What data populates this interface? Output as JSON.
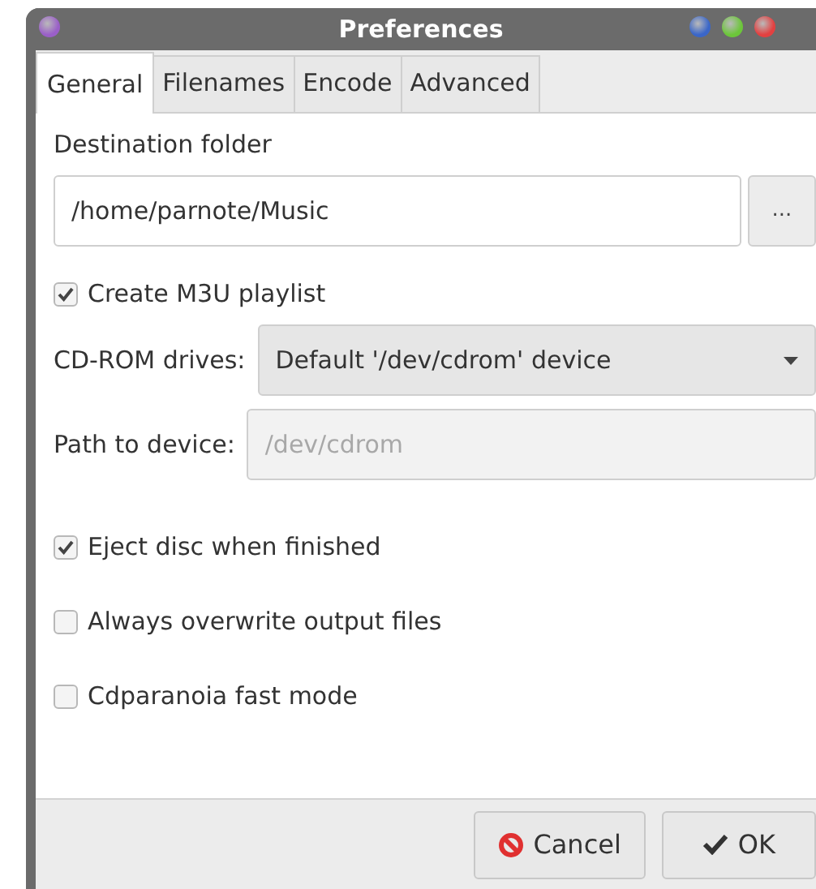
{
  "window": {
    "title": "Preferences"
  },
  "tabs": [
    {
      "label": "General",
      "selected": true
    },
    {
      "label": "Filenames",
      "selected": false
    },
    {
      "label": "Encode",
      "selected": false
    },
    {
      "label": "Advanced",
      "selected": false
    }
  ],
  "rows": [
    {
      "kind": "heading",
      "label": "Destination folder"
    },
    {
      "kind": "folder",
      "value": "/home/parnote/Music",
      "button": "..."
    },
    {
      "kind": "checkbox",
      "label": "Create M3U playlist",
      "checked": true
    },
    {
      "kind": "combo",
      "label": "CD-ROM drives:",
      "value": "Default '/dev/cdrom' device"
    },
    {
      "kind": "field",
      "label": "Path to device:",
      "value": "/dev/cdrom",
      "disabled": true
    },
    {
      "kind": "checkbox",
      "label": "Eject disc when finished",
      "checked": true
    },
    {
      "kind": "checkbox",
      "label": "Always overwrite output files",
      "checked": false
    },
    {
      "kind": "checkbox",
      "label": "Cdparanoia fast mode",
      "checked": false
    }
  ],
  "buttons": [
    {
      "label": "Cancel",
      "kind": "cancel"
    },
    {
      "label": "OK",
      "kind": "ok"
    }
  ]
}
